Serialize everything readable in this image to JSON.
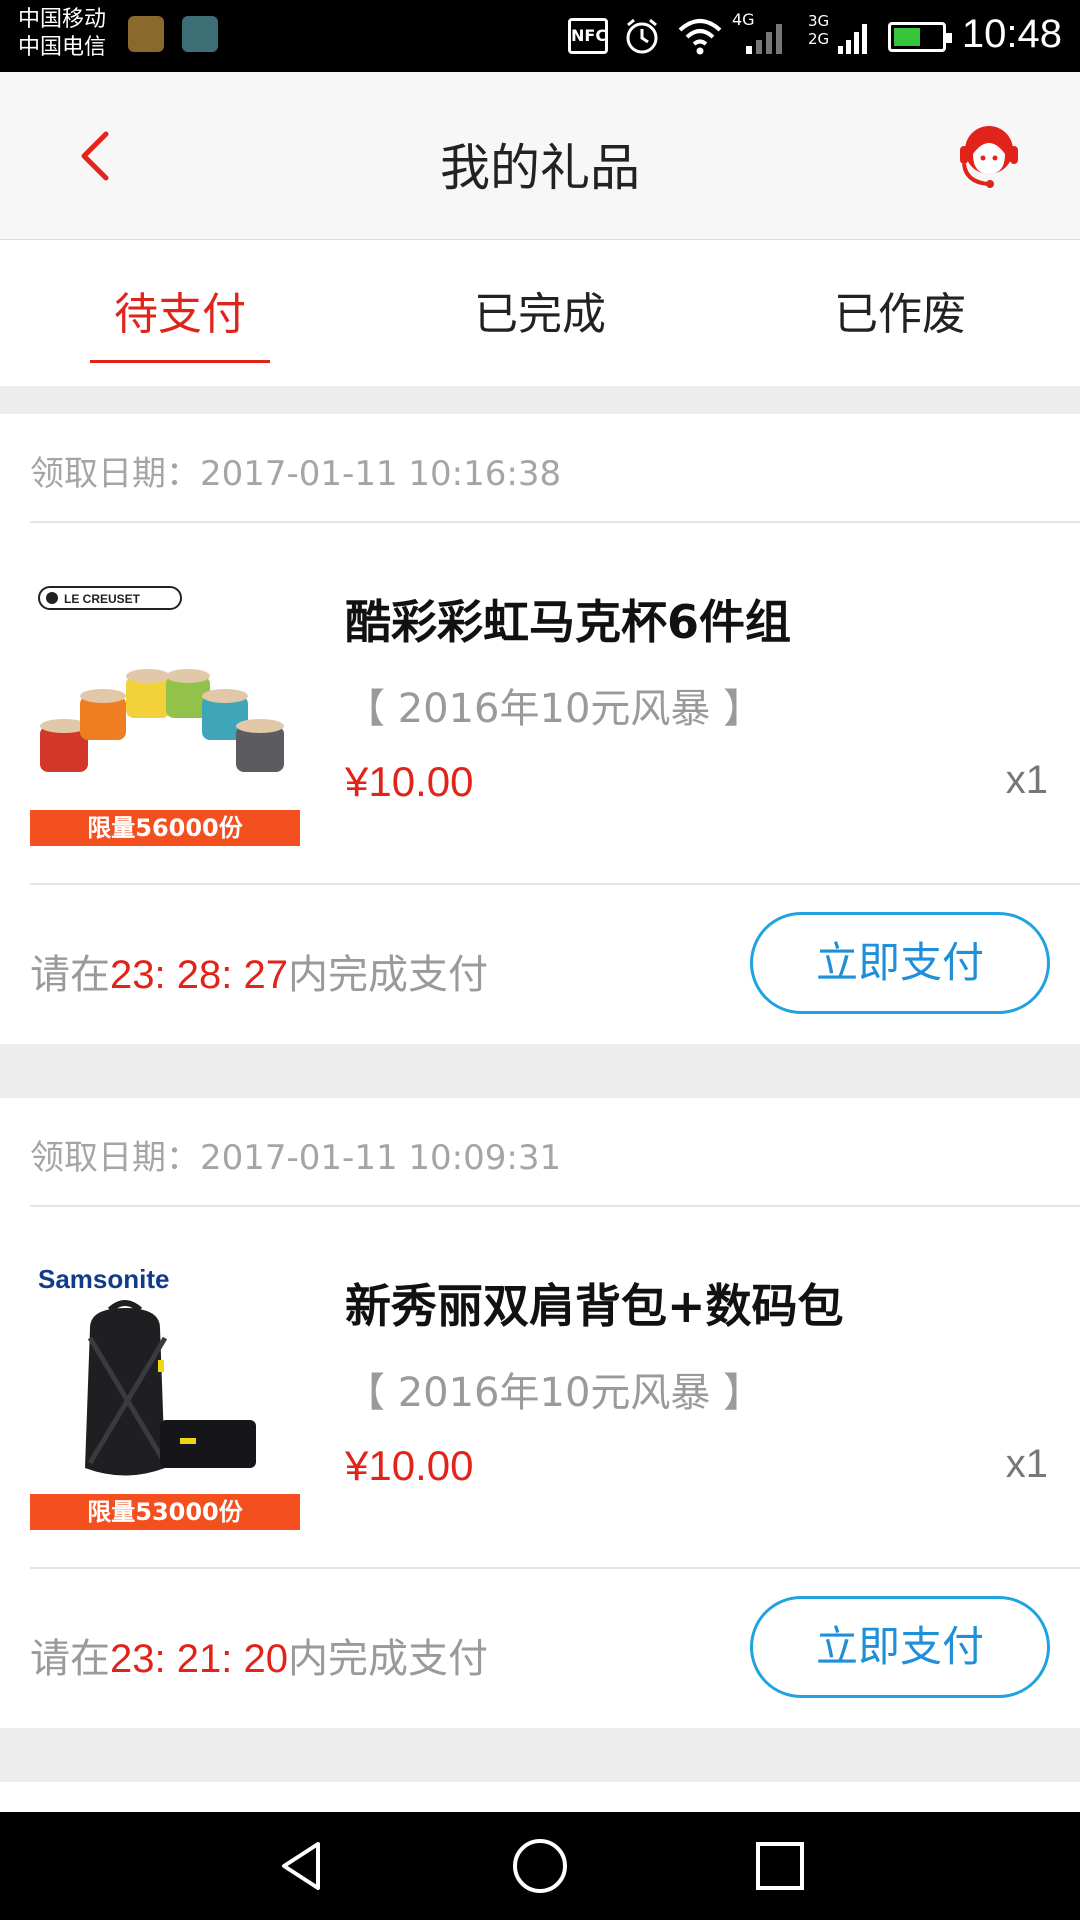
{
  "status_bar": {
    "carrier_1": "中国移动",
    "carrier_2": "中国电信",
    "nfc": "NFC",
    "net_4g": "4G",
    "net_3g": "3G",
    "net_2g": "2G",
    "time": "10:48"
  },
  "header": {
    "title": "我的礼品",
    "back_icon": "chevron-left-icon",
    "service_icon": "customer-service-icon"
  },
  "tabs": [
    {
      "label": "待支付",
      "active": true
    },
    {
      "label": "已完成",
      "active": false
    },
    {
      "label": "已作废",
      "active": false
    }
  ],
  "orders": [
    {
      "date_label": "领取日期：",
      "date_value": "2017-01-11 10:16:38",
      "brand": "LE CREUSET",
      "limit_badge": "限量56000份",
      "name": "酷彩彩虹马克杯6件组",
      "promo": "【 2016年10元风暴 】",
      "price": "¥10.00",
      "qty": "x1",
      "countdown_prefix": "请在",
      "countdown_h": "23",
      "countdown_m": "28",
      "countdown_s": "27",
      "countdown_suffix": "内完成支付",
      "pay_label": "立即支付"
    },
    {
      "date_label": "领取日期：",
      "date_value": "2017-01-11 10:09:31",
      "brand": "Samsonite",
      "limit_badge": "限量53000份",
      "name": "新秀丽双肩背包+数码包",
      "promo": "【 2016年10元风暴 】",
      "price": "¥10.00",
      "qty": "x1",
      "countdown_prefix": "请在",
      "countdown_h": "23",
      "countdown_m": "21",
      "countdown_s": "20",
      "countdown_suffix": "内完成支付",
      "pay_label": "立即支付"
    }
  ],
  "colors": {
    "accent_red": "#e2231a",
    "pay_blue": "#1fa3e0",
    "badge_orange": "#f4501f"
  },
  "nav_bar": {
    "back_icon": "triangle-back-icon",
    "home_icon": "circle-home-icon",
    "recent_icon": "square-recent-icon"
  }
}
